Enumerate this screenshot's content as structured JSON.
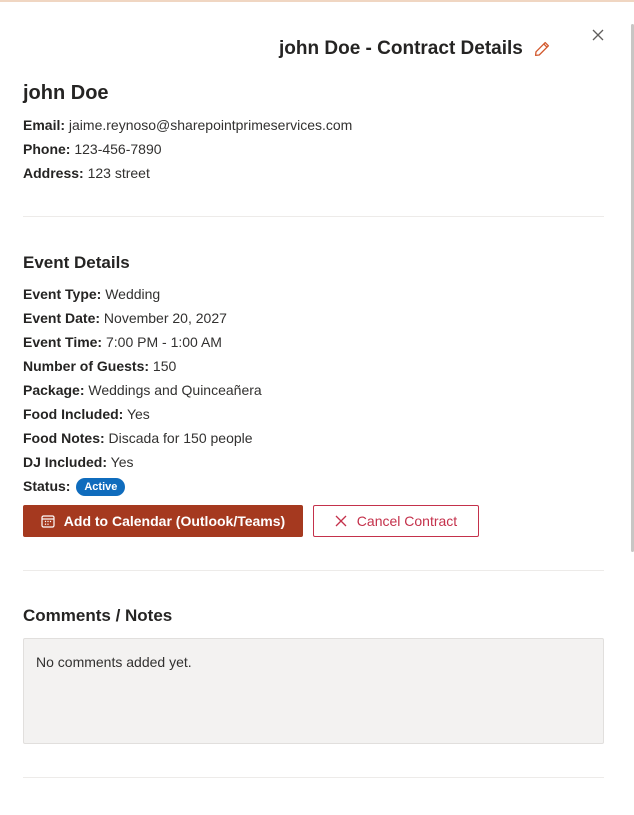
{
  "header": {
    "title": "john Doe - Contract Details"
  },
  "icons": {
    "edit": "pencil-icon",
    "close": "close-icon",
    "calendar": "calendar-icon",
    "cancel": "x-icon"
  },
  "colors": {
    "primary": "#a5391f",
    "danger": "#c4314b",
    "badge": "#0f6cbd",
    "edit_icon": "#d2582c"
  },
  "client": {
    "name": "john Doe",
    "email_label": "Email:",
    "email": "jaime.reynoso@sharepointprimeservices.com",
    "phone_label": "Phone:",
    "phone": "123-456-7890",
    "address_label": "Address:",
    "address": "123 street"
  },
  "event": {
    "heading": "Event Details",
    "type_label": "Event Type:",
    "type": "Wedding",
    "date_label": "Event Date:",
    "date": "November 20, 2027",
    "time_label": "Event Time:",
    "time": "7:00 PM - 1:00 AM",
    "guests_label": "Number of Guests:",
    "guests": "150",
    "package_label": "Package:",
    "package": "Weddings and Quinceañera",
    "food_label": "Food Included:",
    "food": "Yes",
    "food_notes_label": "Food Notes:",
    "food_notes": "Discada for 150 people",
    "dj_label": "DJ Included:",
    "dj": "Yes",
    "status_label": "Status:",
    "status": "Active"
  },
  "actions": {
    "add_calendar": "Add to Calendar (Outlook/Teams)",
    "cancel_contract": "Cancel Contract"
  },
  "comments": {
    "heading": "Comments / Notes",
    "empty_text": "No comments added yet."
  }
}
